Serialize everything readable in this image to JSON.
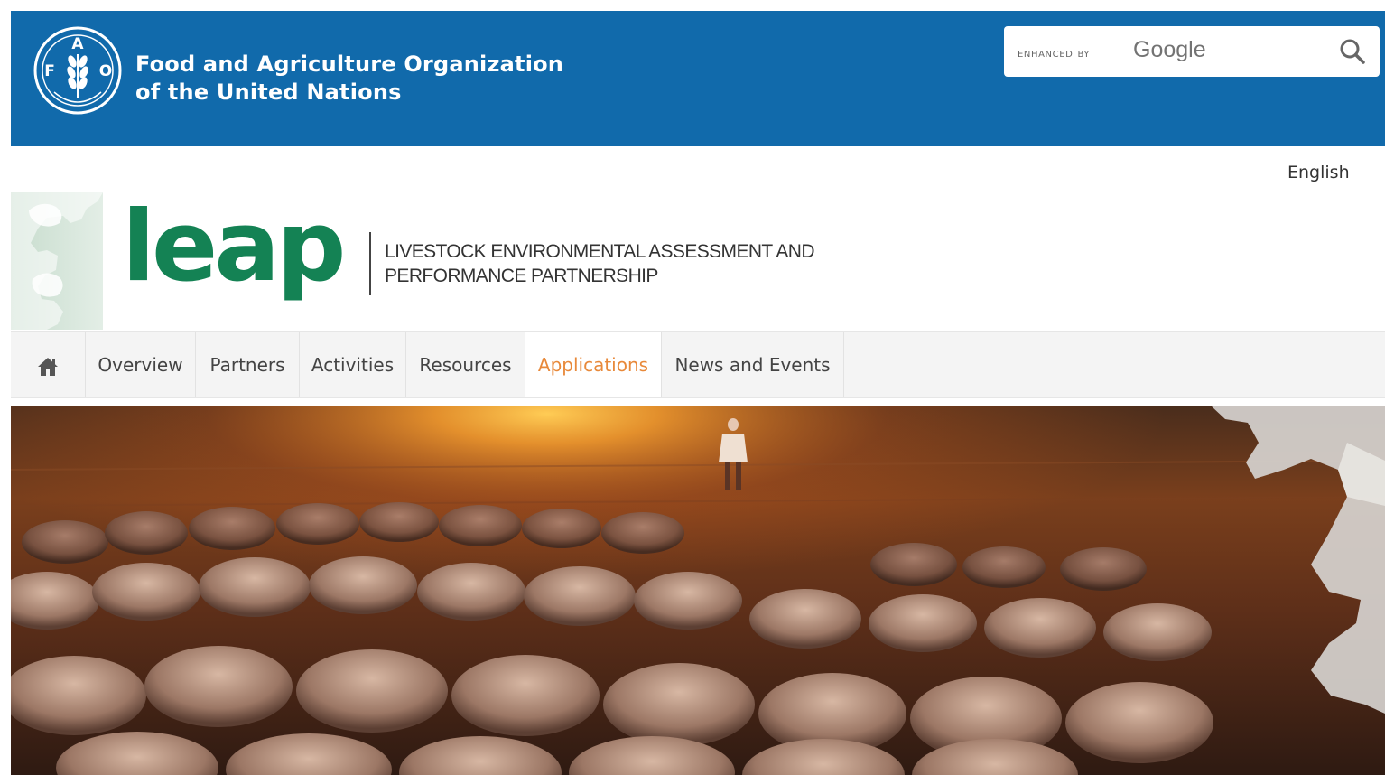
{
  "fao": {
    "org_line_1": "Food and Agriculture Organization",
    "org_line_2": "of the United Nations",
    "logo_letters": [
      "F",
      "A",
      "O"
    ],
    "brand_color": "#116aab"
  },
  "search": {
    "enhanced_label": "enhanced by",
    "provider": "Google",
    "button_icon": "magnifier-icon"
  },
  "language": {
    "current": "English"
  },
  "leap": {
    "logo_word": "leap",
    "tagline_line_1": "LIVESTOCK ENVIRONMENTAL ASSESSMENT AND",
    "tagline_line_2": "PERFORMANCE PARTNERSHIP",
    "brand_color": "#148254"
  },
  "nav": {
    "home_icon": "home-icon",
    "items": [
      {
        "label": "Overview",
        "active": false
      },
      {
        "label": "Partners",
        "active": false
      },
      {
        "label": "Activities",
        "active": false
      },
      {
        "label": "Resources",
        "active": false
      },
      {
        "label": "Applications",
        "active": true
      },
      {
        "label": "News and Events",
        "active": false
      }
    ],
    "active_color": "#e8893a"
  },
  "hero": {
    "image": "sheep-flock-at-sunset-photo"
  }
}
